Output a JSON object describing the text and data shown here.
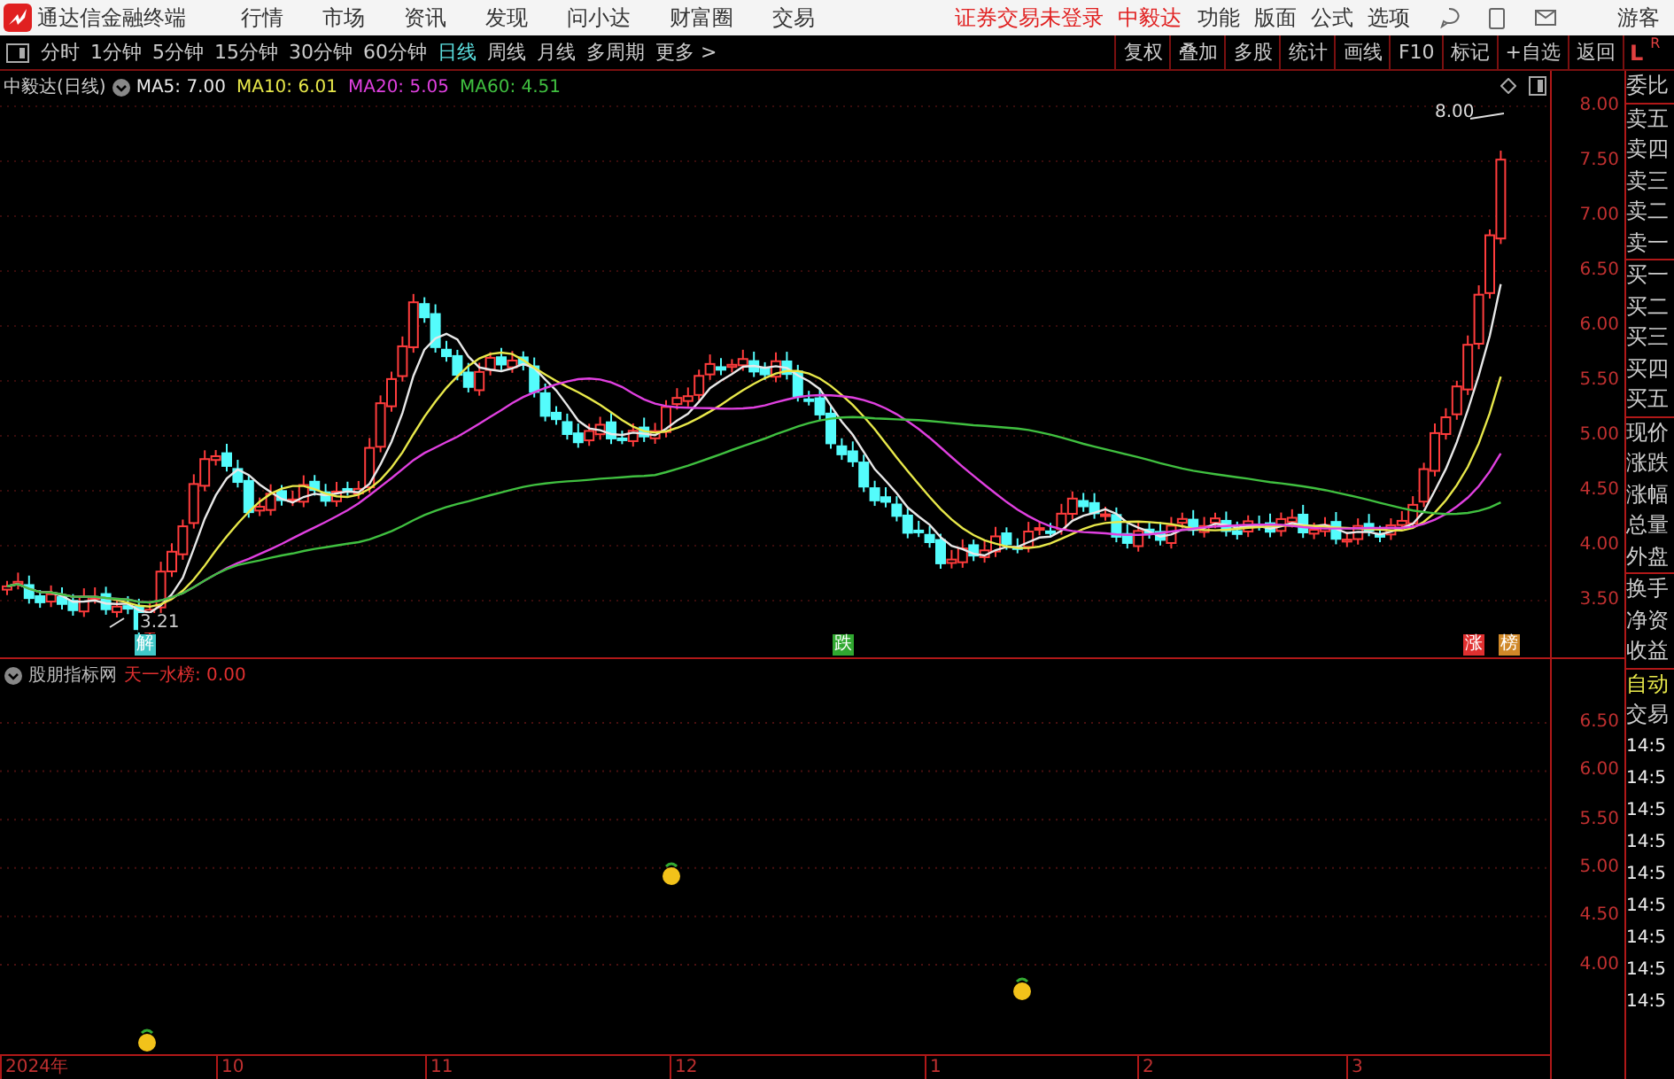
{
  "menu_bar": {
    "app_title": "通达信金融终端",
    "items": [
      "行情",
      "市场",
      "资讯",
      "发现",
      "问小达",
      "财富圈",
      "交易"
    ],
    "login_status": "证券交易未登录",
    "stock_name": "中毅达",
    "right_items": [
      "功能",
      "版面",
      "公式",
      "选项"
    ],
    "user": "游客"
  },
  "period_tabs": [
    {
      "label": "分时",
      "selected": false
    },
    {
      "label": "1分钟",
      "selected": false
    },
    {
      "label": "5分钟",
      "selected": false
    },
    {
      "label": "15分钟",
      "selected": false
    },
    {
      "label": "30分钟",
      "selected": false
    },
    {
      "label": "60分钟",
      "selected": false
    },
    {
      "label": "日线",
      "selected": true
    },
    {
      "label": "周线",
      "selected": false
    },
    {
      "label": "月线",
      "selected": false
    },
    {
      "label": "多周期",
      "selected": false
    },
    {
      "label": "更多 >",
      "selected": false
    }
  ],
  "tool_buttons": [
    "复权",
    "叠加",
    "多股",
    "统计",
    "画线",
    "F10",
    "标记",
    "+自选",
    "返回"
  ],
  "panel_switch": {
    "left": "L",
    "right": "R"
  },
  "main_chart": {
    "title": "中毅达(日线)",
    "indicators": [
      {
        "label": "MA5: 7.00",
        "color": "#e8e8e8"
      },
      {
        "label": "MA10: 6.01",
        "color": "#e8e84a"
      },
      {
        "label": "MA20: 5.05",
        "color": "#e040e0"
      },
      {
        "label": "MA60: 4.51",
        "color": "#40c040"
      }
    ],
    "high_label": "8.00",
    "low_label": "3.21",
    "signals": [
      {
        "label": "解",
        "color": "#40c8c8"
      },
      {
        "label": "跌",
        "color": "#30a830"
      },
      {
        "label": "涨",
        "color": "#e03030"
      },
      {
        "label": "榜",
        "color": "#d08828"
      }
    ],
    "y_ticks": [
      "8.00",
      "7.50",
      "7.00",
      "6.50",
      "6.00",
      "5.50",
      "5.00",
      "4.50",
      "4.00",
      "3.50"
    ]
  },
  "sub_chart": {
    "title": "股朋指标网",
    "indicator": "天一水榜: 0.00",
    "y_ticks": [
      "6.50",
      "6.00",
      "5.50",
      "5.00",
      "4.50",
      "4.00"
    ]
  },
  "x_axis": [
    "2024年",
    "10",
    "11",
    "12",
    "1",
    "2",
    "3"
  ],
  "quote_panel": {
    "groups": [
      [
        "委比"
      ],
      [
        "卖五",
        "卖四",
        "卖三",
        "卖二",
        "卖一"
      ],
      [
        "买一",
        "买二",
        "买三",
        "买四",
        "买五"
      ],
      [
        "现价",
        "涨跌",
        "涨幅",
        "总量",
        "外盘"
      ],
      [
        "换手",
        "净资",
        "收益"
      ]
    ],
    "auto_label": "自动",
    "trade_label": "交易",
    "times": [
      "14:5",
      "14:5",
      "14:5",
      "14:5",
      "14:5",
      "14:5",
      "14:5",
      "14:5",
      "14:5"
    ]
  }
}
